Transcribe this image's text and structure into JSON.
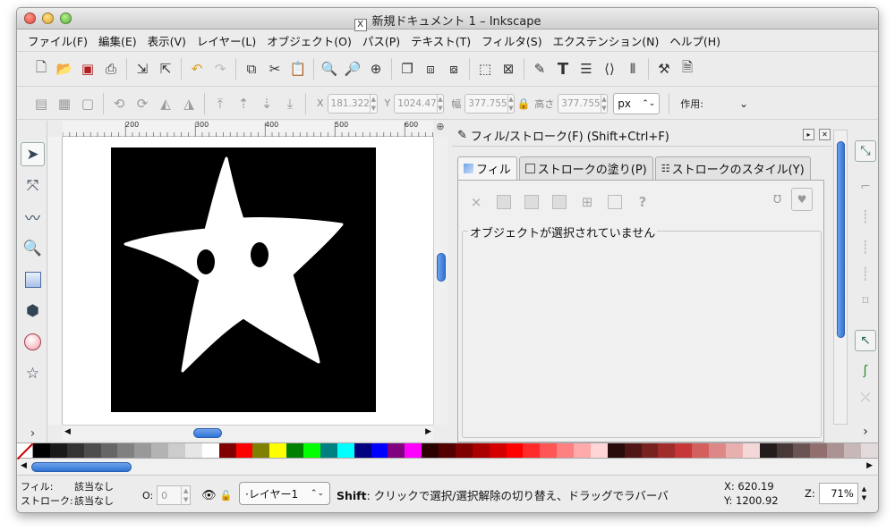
{
  "window": {
    "title": "新規ドキュメント 1 – Inkscape"
  },
  "menu": [
    "ファイル(F)",
    "編集(E)",
    "表示(V)",
    "レイヤー(L)",
    "オブジェクト(O)",
    "パス(P)",
    "テキスト(T)",
    "フィルタ(S)",
    "エクステンション(N)",
    "ヘルプ(H)"
  ],
  "toolbar2": {
    "x_label": "X",
    "x_value": "181.322",
    "y_label": "Y",
    "y_value": "1024.47",
    "w_label": "幅",
    "w_value": "377.755",
    "h_label": "高さ",
    "h_value": "377.755",
    "unit": "px",
    "apply_label": "作用:"
  },
  "ruler_ticks": [
    "200",
    "300",
    "400",
    "500",
    "600"
  ],
  "dock": {
    "title": "フィル/ストローク(F) (Shift+Ctrl+F)",
    "tabs": [
      "フィル",
      "ストロークの塗り(P)",
      "ストロークのスタイル(Y)"
    ],
    "no_selection": "オブジェクトが選択されていません"
  },
  "palette_colors": [
    "#000000",
    "#1a1a1a",
    "#333333",
    "#4d4d4d",
    "#666666",
    "#808080",
    "#999999",
    "#b3b3b3",
    "#cccccc",
    "#e6e6e6",
    "#ffffff",
    "#800000",
    "#ff0000",
    "#808000",
    "#ffff00",
    "#008000",
    "#00ff00",
    "#008080",
    "#00ffff",
    "#000080",
    "#0000ff",
    "#800080",
    "#ff00ff",
    "#2b0000",
    "#550000",
    "#800000",
    "#aa0000",
    "#d40000",
    "#ff0000",
    "#ff2a2a",
    "#ff5555",
    "#ff8080",
    "#ffaaaa",
    "#ffd5d5",
    "#280b0b",
    "#501616",
    "#782121",
    "#a02c2c",
    "#c83737",
    "#d35f5f",
    "#de8787",
    "#e9afaf",
    "#f4d7d7",
    "#241c1c",
    "#483737",
    "#6c5353",
    "#916f6f",
    "#ac9393",
    "#c8b7b7",
    "#e3dbdb"
  ],
  "status": {
    "fill_label": "フィル:",
    "fill_value": "該当なし",
    "stroke_label": "ストローク:",
    "stroke_value": "該当なし",
    "o_label": "O:",
    "o_value": "0",
    "layer": "·レイヤー1",
    "msg_key": "Shift",
    "msg": ": クリックで選択/選択解除の切り替え、ドラッグでラバーバ",
    "x_label": "X:",
    "x_value": "620.19",
    "y_label": "Y:",
    "y_value": "1200.92",
    "zoom_label": "Z:",
    "zoom_value": "71%"
  }
}
